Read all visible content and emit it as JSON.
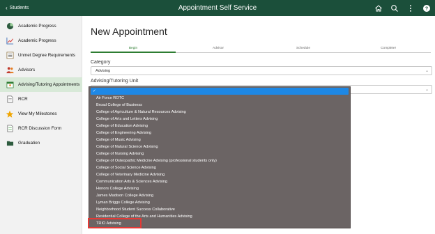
{
  "topbar": {
    "back_label": "Students",
    "title": "Appointment Self Service",
    "icons": [
      "home-icon",
      "search-icon",
      "more-vertical-icon",
      "help-icon"
    ]
  },
  "sidebar": {
    "items": [
      {
        "label": "Academic Progress",
        "icon": "pie-chart-icon",
        "active": false
      },
      {
        "label": "Academic Progress",
        "icon": "line-chart-icon",
        "active": false
      },
      {
        "label": "Unmet Degree Requirements",
        "icon": "list-icon",
        "active": false
      },
      {
        "label": "Advisors",
        "icon": "people-icon",
        "active": false
      },
      {
        "label": "Advising/Tutoring Appointments",
        "icon": "calendar-person-icon",
        "active": true
      },
      {
        "label": "RCR",
        "icon": "document-icon",
        "active": false
      },
      {
        "label": "View My Milestones",
        "icon": "star-icon",
        "active": false
      },
      {
        "label": "RCR Discussion Form",
        "icon": "form-icon",
        "active": false
      },
      {
        "label": "Graduation",
        "icon": "folder-icon",
        "active": false
      }
    ]
  },
  "main": {
    "page_title": "New Appointment",
    "steps": [
      "Begin",
      "Advisor",
      "Schedule",
      "Complete!"
    ],
    "category": {
      "label": "Category",
      "value": "Advising"
    },
    "unit": {
      "label": "Advising/Tutoring Unit"
    }
  },
  "dropdown": {
    "selected_marker": "✓",
    "options": [
      "Air Force ROTC",
      "Broad College of Business",
      "College of Agriculture & Natural Resources Advising",
      "College of Arts and Letters Advising",
      "College of Education Advising",
      "College of Engineering Advising",
      "College of Music Advising",
      "College of Natural Science Advising",
      "College of Nursing Advising",
      "College of Osteopathic Medicine Advising (professional students only)",
      "College of Social Science Advising",
      "College of Veterinary Medicine Advising",
      "Communication Arts & Sciences Advising",
      "Honors College Advising",
      "James Madison College Advising",
      "Lyman Briggs College Advising",
      "Neighborhood Student Success Collaborative",
      "Residential College of the Arts and Humanities Advising",
      "TRIO Advising"
    ]
  },
  "colors": {
    "header": "#1b4f3a",
    "accent": "#2e7d32",
    "selected_option": "#1e88e5",
    "highlight": "#e53935",
    "dropdown_bg": "#6b6464"
  }
}
